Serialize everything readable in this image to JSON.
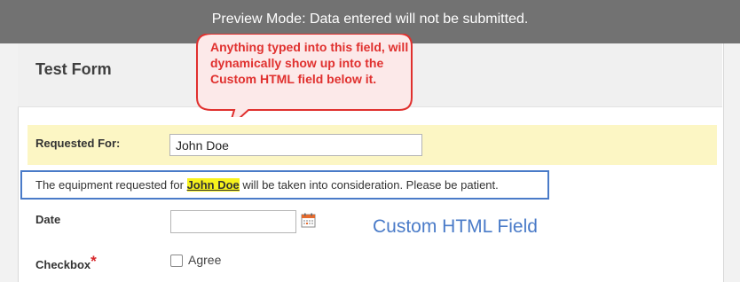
{
  "preview_banner": {
    "text": "Preview Mode: Data entered will not be submitted."
  },
  "form": {
    "title": "Test Form",
    "requested_for": {
      "label": "Requested For:",
      "value": "John Doe"
    },
    "html_field": {
      "before": "The equipment requested for ",
      "name": "John Doe",
      "after": " will be taken into consideration. Please be patient."
    },
    "date": {
      "label": "Date",
      "value": "",
      "icon": "calendar-icon"
    },
    "checkbox": {
      "label": "Checkbox",
      "required_mark": "*",
      "option_label": "Agree",
      "checked": false
    }
  },
  "annotations": {
    "callout_text": "Anything typed into this field, will dynamically show up into the Custom HTML field below it.",
    "custom_html_label": "Custom HTML Field",
    "callout_color": "#e0302e",
    "box_color": "#4a7bc8"
  }
}
